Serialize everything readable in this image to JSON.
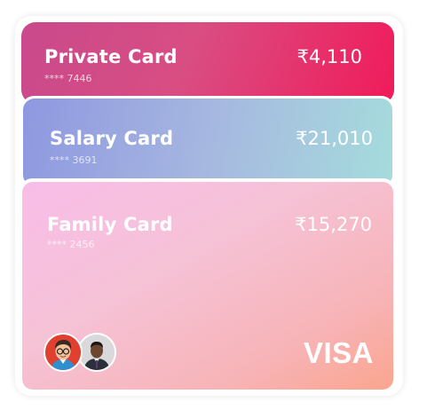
{
  "cards": [
    {
      "id": "private",
      "name": "Private Card",
      "masked_number": "**** 7446",
      "balance": "₹4,110"
    },
    {
      "id": "salary",
      "name": "Salary Card",
      "masked_number": "**** 3691",
      "balance": "₹21,010"
    },
    {
      "id": "family",
      "name": "Family Card",
      "masked_number": "**** 2456",
      "balance": "₹15,270",
      "network": "VISA",
      "members": [
        "avatar-cartoon-man",
        "avatar-man-photo"
      ]
    }
  ],
  "colors": {
    "private_gradient": [
      "#c94a8c",
      "#f01b5a"
    ],
    "salary_gradient": [
      "#8e98e0",
      "#a5dcdc"
    ],
    "family_gradient": [
      "#f8bde8",
      "#fba58e"
    ]
  }
}
